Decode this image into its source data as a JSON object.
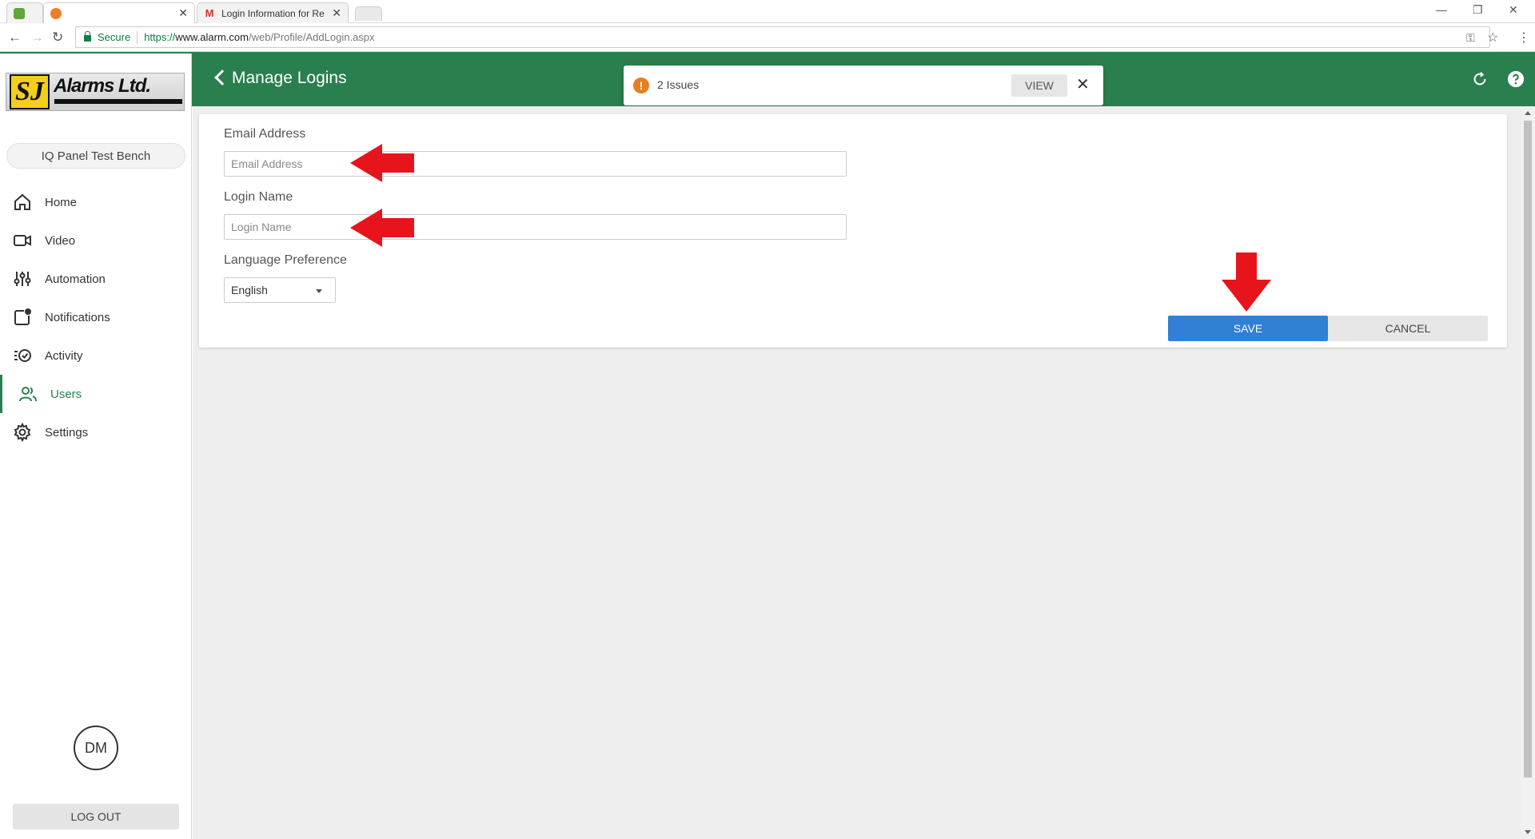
{
  "browser": {
    "tabs": [
      {
        "title": "",
        "favicon_color": "#62a53e"
      },
      {
        "title": "",
        "favicon_color": "#f07d29"
      },
      {
        "title": "Login Information for Re",
        "favicon_color": "#d93025"
      }
    ],
    "security_label": "Secure",
    "url": {
      "scheme": "https://",
      "host": "www.alarm.com",
      "path": "/web/Profile/AddLogin.aspx"
    }
  },
  "sidebar": {
    "logo": {
      "mark": "SJ",
      "name": "Alarms Ltd."
    },
    "panel_name": "IQ Panel Test Bench",
    "items": [
      {
        "label": "Home",
        "icon": "home-icon",
        "active": false
      },
      {
        "label": "Video",
        "icon": "video-icon",
        "active": false
      },
      {
        "label": "Automation",
        "icon": "automation-icon",
        "active": false
      },
      {
        "label": "Notifications",
        "icon": "notifications-icon",
        "active": false
      },
      {
        "label": "Activity",
        "icon": "activity-icon",
        "active": false
      },
      {
        "label": "Users",
        "icon": "users-icon",
        "active": true
      },
      {
        "label": "Settings",
        "icon": "gear-icon",
        "active": false
      }
    ],
    "avatar_initials": "DM",
    "logout_label": "LOG OUT"
  },
  "header": {
    "title": "Manage Logins",
    "issues": {
      "text": "2 Issues",
      "view_label": "VIEW"
    }
  },
  "form": {
    "email": {
      "label": "Email Address",
      "placeholder": "Email Address",
      "value": ""
    },
    "login": {
      "label": "Login Name",
      "placeholder": "Login Name",
      "value": ""
    },
    "language": {
      "label": "Language Preference",
      "selected": "English"
    },
    "save_label": "SAVE",
    "cancel_label": "CANCEL"
  },
  "colors": {
    "brand_green": "#2a7f4f",
    "save_blue": "#2f80d6",
    "annotation_red": "#e8141c",
    "warning_orange": "#e67e22"
  }
}
